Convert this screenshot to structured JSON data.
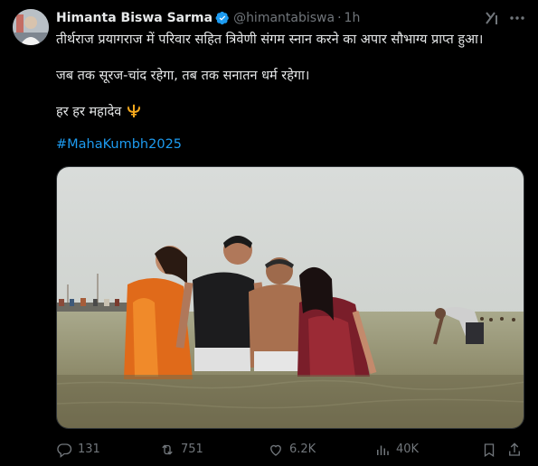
{
  "tweet": {
    "author_name": "Himanta Biswa Sarma",
    "handle": "@himantabiswa",
    "separator": "·",
    "time": "1h",
    "line1": "तीर्थराज प्रयागराज में परिवार सहित त्रिवेणी संगम स्नान करने का अपार सौभाग्य प्राप्त हुआ।",
    "line2": "जब तक सूरज-चांद रहेगा, तब तक सनातन धर्म रहेगा।",
    "line3": "हर हर महादेव",
    "hashtag": "#MahaKumbh2025",
    "emoji_icon": "trident-icon"
  },
  "actions": {
    "replies": "131",
    "reposts": "751",
    "likes": "6.2K",
    "views": "40K"
  },
  "colors": {
    "background": "#000000",
    "text": "#e7e9ea",
    "muted": "#71767b",
    "link": "#1d9bf0",
    "verified": "#1d9bf0"
  },
  "icons": {
    "verified": "verified-badge-icon",
    "grok": "grok-icon",
    "more": "more-icon",
    "reply": "reply-icon",
    "repost": "repost-icon",
    "like": "heart-icon",
    "views": "views-chart-icon",
    "bookmark": "bookmark-icon",
    "share": "share-icon"
  }
}
